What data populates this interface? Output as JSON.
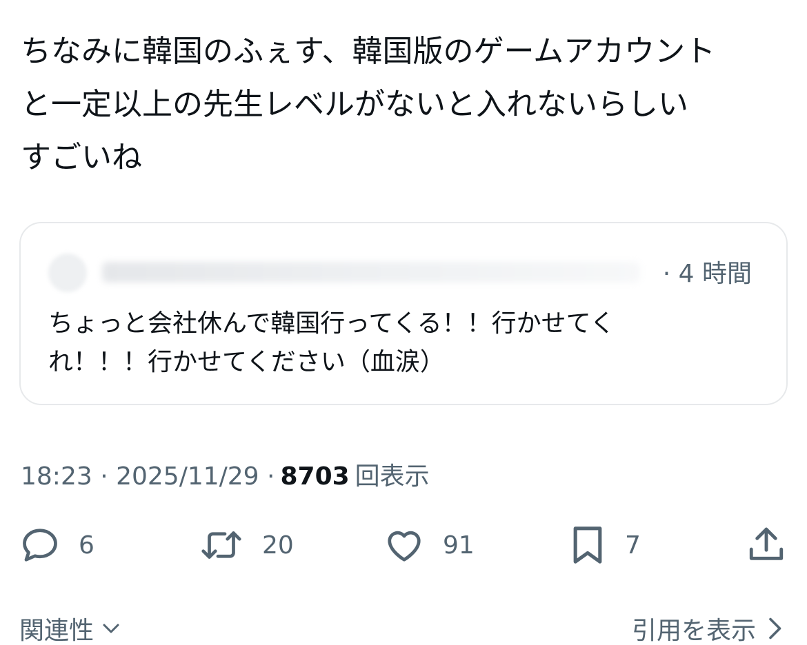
{
  "tweet": {
    "text_lines": [
      "ちなみに韓国のふぇす、韓国版のゲームアカウント",
      "と一定以上の先生レベルがないと入れないらしい",
      "すごいね"
    ]
  },
  "quote": {
    "time_meta": "· 4 時間",
    "text_lines": [
      "ちょっと会社休んで韓国行ってくる！！行かせてく",
      "れ！！！行かせてください（血涙）"
    ]
  },
  "meta": {
    "time": "18:23 · 2025/11/29 ·",
    "views_count": "8703",
    "views_label": "回表示"
  },
  "actions": {
    "reply": {
      "icon": "reply-icon",
      "count": "6"
    },
    "retweet": {
      "icon": "retweet-icon",
      "count": "20"
    },
    "like": {
      "icon": "heart-icon",
      "count": "91"
    },
    "bookmark": {
      "icon": "bookmark-icon",
      "count": "7"
    },
    "share": {
      "icon": "share-icon"
    }
  },
  "footer": {
    "related_label": "関連性",
    "quotes_label": "引用を表示"
  },
  "colors": {
    "text": "#0f1419",
    "secondary": "#536471",
    "border": "#e7e9eb"
  }
}
